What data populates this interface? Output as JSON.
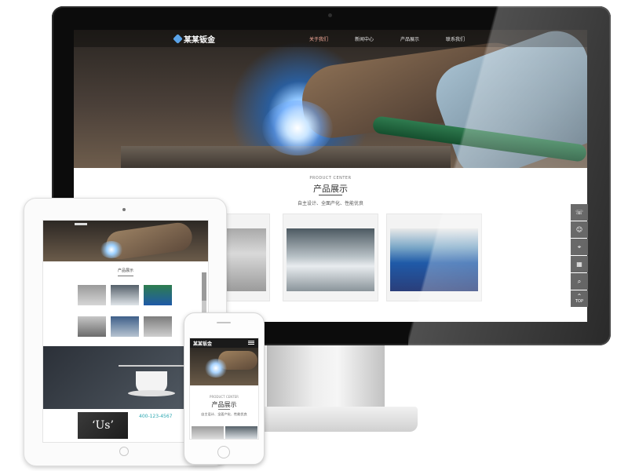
{
  "site": {
    "logo_text": "某某钣金",
    "nav": [
      "关于我们",
      "新闻中心",
      "产品展示",
      "联系我们"
    ]
  },
  "products": {
    "heading_en": "PRODUCT CENTER",
    "heading_cn": "产品展示",
    "subtitle": "自主设计、全面产化、性能优良"
  },
  "side_tools": {
    "phone_icon": "☏",
    "service_icon": "☺",
    "location_icon": "⌖",
    "qrcode_icon": "▦",
    "search_icon": "⌕",
    "top_arrow": "⌃",
    "top_label": "TOP"
  },
  "tablet": {
    "products_title": "产品展示",
    "about_label": "‘Us’",
    "phone_number": "400-123-4567"
  },
  "mobile": {
    "logo_text": "某某钣金",
    "heading_en": "PRODUCT CENTER",
    "heading_cn": "产品展示",
    "subtitle": "自主设计、全面产化、性能优良"
  }
}
